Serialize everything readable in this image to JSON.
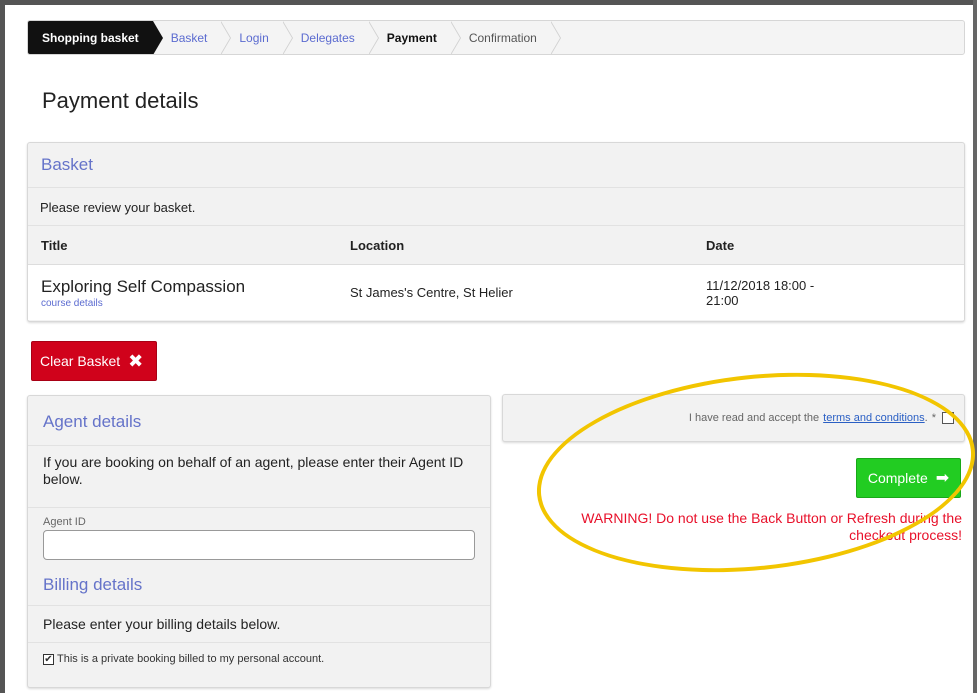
{
  "breadcrumb": {
    "items": [
      {
        "label": "Shopping basket",
        "state": "first"
      },
      {
        "label": "Basket",
        "state": "link"
      },
      {
        "label": "Login",
        "state": "link"
      },
      {
        "label": "Delegates",
        "state": "link"
      },
      {
        "label": "Payment",
        "state": "current"
      },
      {
        "label": "Confirmation",
        "state": "plain"
      }
    ]
  },
  "page": {
    "title": "Payment details"
  },
  "basket": {
    "heading": "Basket",
    "intro": "Please review your basket.",
    "columns": [
      "Title",
      "Location",
      "Date"
    ],
    "rows": [
      {
        "title": "Exploring Self Compassion",
        "link": "course details",
        "location": "St James's Centre, St Helier",
        "date_line1": "11/12/2018 18:00 -",
        "date_line2": "21:00"
      }
    ]
  },
  "clear_basket": {
    "label": "Clear Basket",
    "icon": "close-icon"
  },
  "agent": {
    "heading": "Agent details",
    "intro": "If you are booking on behalf of an agent, please enter their Agent ID below.",
    "field_label": "Agent ID",
    "field_value": ""
  },
  "billing": {
    "heading": "Billing details",
    "intro": "Please enter your billing details below.",
    "private_label": "This is a private booking billed to my personal account.",
    "private_checked": true
  },
  "terms": {
    "prefix": "I have read and accept the",
    "link": "terms and conditions",
    "suffix": ".",
    "required": "*",
    "checked": false
  },
  "complete": {
    "label": "Complete",
    "icon": "arrow-right-icon"
  },
  "warning": "WARNING! Do not use the Back Button or Refresh during the checkout process!",
  "colors": {
    "accent": "#6573c9",
    "clear": "#d0021b",
    "complete": "#22cc22",
    "warning": "#e8102a",
    "highlight": "#f2c500"
  }
}
